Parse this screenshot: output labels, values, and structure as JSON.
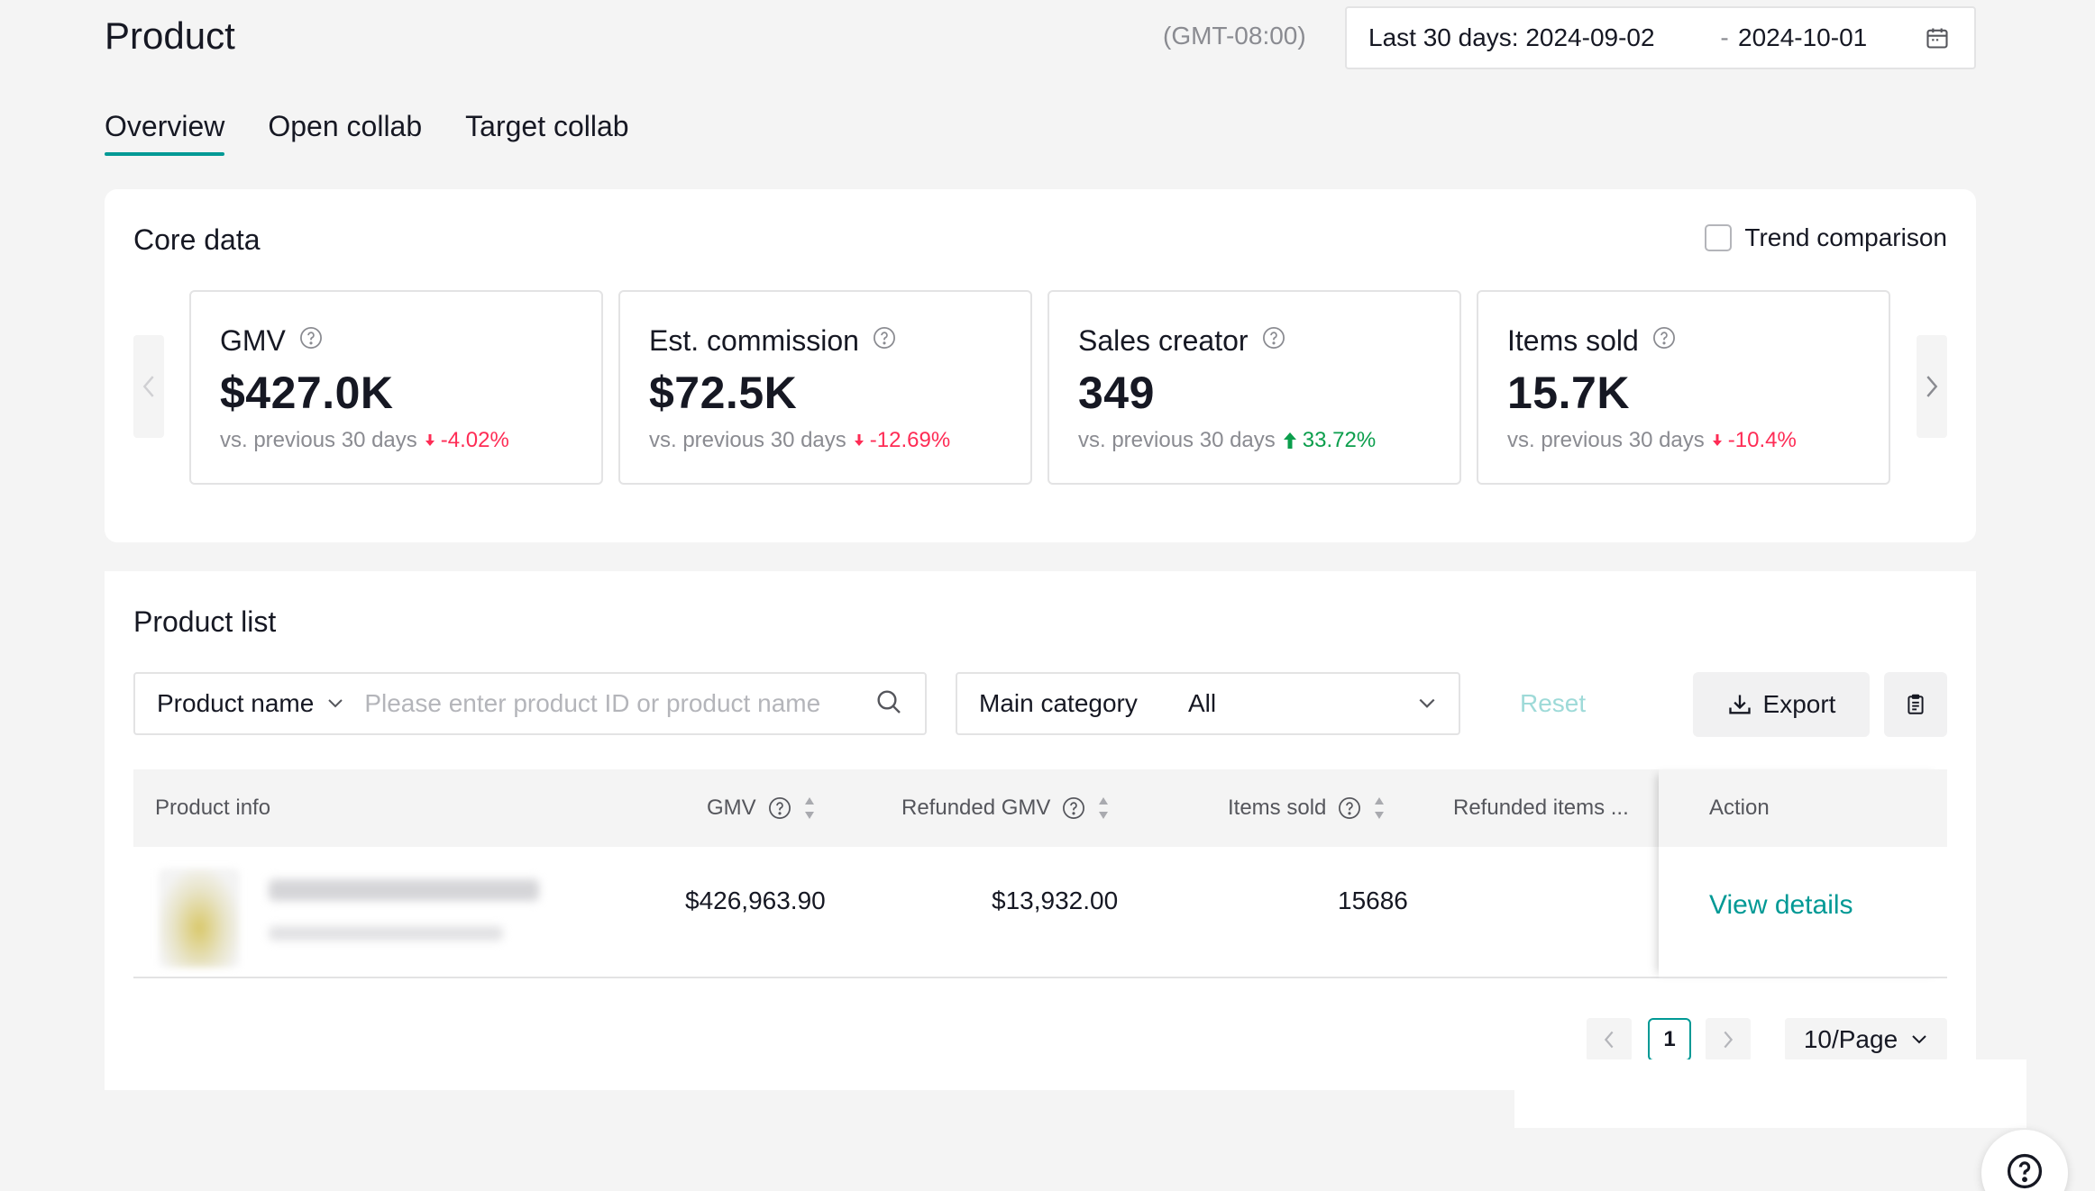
{
  "header": {
    "title": "Product",
    "timezone": "(GMT-08:00)",
    "date_start": "Last 30 days: 2024-09-02",
    "date_sep": "-",
    "date_end": "2024-10-01"
  },
  "tabs": [
    {
      "label": "Overview",
      "active": true
    },
    {
      "label": "Open collab",
      "active": false
    },
    {
      "label": "Target collab",
      "active": false
    }
  ],
  "core_data": {
    "title": "Core data",
    "trend_label": "Trend comparison",
    "cards": [
      {
        "label": "GMV",
        "value": "$427.0K",
        "compare": "vs. previous 30 days",
        "delta": "-4.02%",
        "direction": "down"
      },
      {
        "label": "Est. commission",
        "value": "$72.5K",
        "compare": "vs. previous 30 days",
        "delta": "-12.69%",
        "direction": "down"
      },
      {
        "label": "Sales creator",
        "value": "349",
        "compare": "vs. previous 30 days",
        "delta": "33.72%",
        "direction": "up"
      },
      {
        "label": "Items sold",
        "value": "15.7K",
        "compare": "vs. previous 30 days",
        "delta": "-10.4%",
        "direction": "down"
      }
    ]
  },
  "product_list": {
    "title": "Product list",
    "search_select": "Product name",
    "search_placeholder": "Please enter product ID or product name",
    "category_label": "Main category",
    "category_value": "All",
    "reset_label": "Reset",
    "export_label": "Export",
    "columns": {
      "product_info": "Product info",
      "gmv": "GMV",
      "refunded_gmv": "Refunded GMV",
      "items_sold": "Items sold",
      "refunded_items": "Refunded items ...",
      "action": "Action"
    },
    "rows": [
      {
        "gmv": "$426,963.90",
        "refunded_gmv": "$13,932.00",
        "items_sold": "15686",
        "action": "View details"
      }
    ],
    "pagination": {
      "current_page": "1",
      "per_page": "10/Page"
    }
  },
  "colors": {
    "accent": "#009995",
    "down": "#fe2c55",
    "up": "#0b9e4c"
  }
}
